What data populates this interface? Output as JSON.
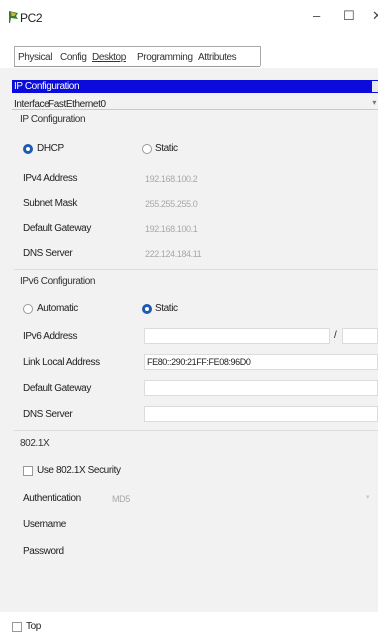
{
  "window": {
    "title": "PC2",
    "minimize": "–",
    "maximize": "☐",
    "close": "✕"
  },
  "tabs": [
    "Physical",
    "Config",
    "Desktop",
    "Programming",
    "Attributes"
  ],
  "ip_config": {
    "title": "IP Configuration",
    "interface_label": "Interface",
    "interface_value": "FastEthernet0",
    "ipv4_section": "IP Configuration",
    "dhcp_label": "DHCP",
    "static_label": "Static",
    "ipv4_mode": "DHCP",
    "ipv4_address_label": "IPv4 Address",
    "ipv4_address": "192.168.100.2",
    "subnet_mask_label": "Subnet Mask",
    "subnet_mask": "255.255.255.0",
    "gateway_label": "Default Gateway",
    "gateway": "192.168.100.1",
    "dns_label": "DNS Server",
    "dns": "222.124.184.11",
    "ipv6_section": "IPv6 Configuration",
    "automatic_label": "Automatic",
    "ipv6_static_label": "Static",
    "ipv6_mode": "Static",
    "ipv6_address_label": "IPv6 Address",
    "ipv6_address": "",
    "ipv6_slash": "/",
    "link_local_label": "Link Local Address",
    "link_local": "FE80::290:21FF:FE08:96D0",
    "ipv6_gateway_label": "Default Gateway",
    "ipv6_gateway": "",
    "ipv6_dns_label": "DNS Server",
    "ipv6_dns": "",
    "dot1x_section": "802.1X",
    "use_dot1x_label": "Use 802.1X Security",
    "auth_label": "Authentication",
    "auth_value": "MD5",
    "username_label": "Username",
    "password_label": "Password"
  },
  "bottom": {
    "top_label": "Top"
  },
  "colors": {
    "accent": "#0b0bdc",
    "radio_on": "#1e5ab4"
  }
}
